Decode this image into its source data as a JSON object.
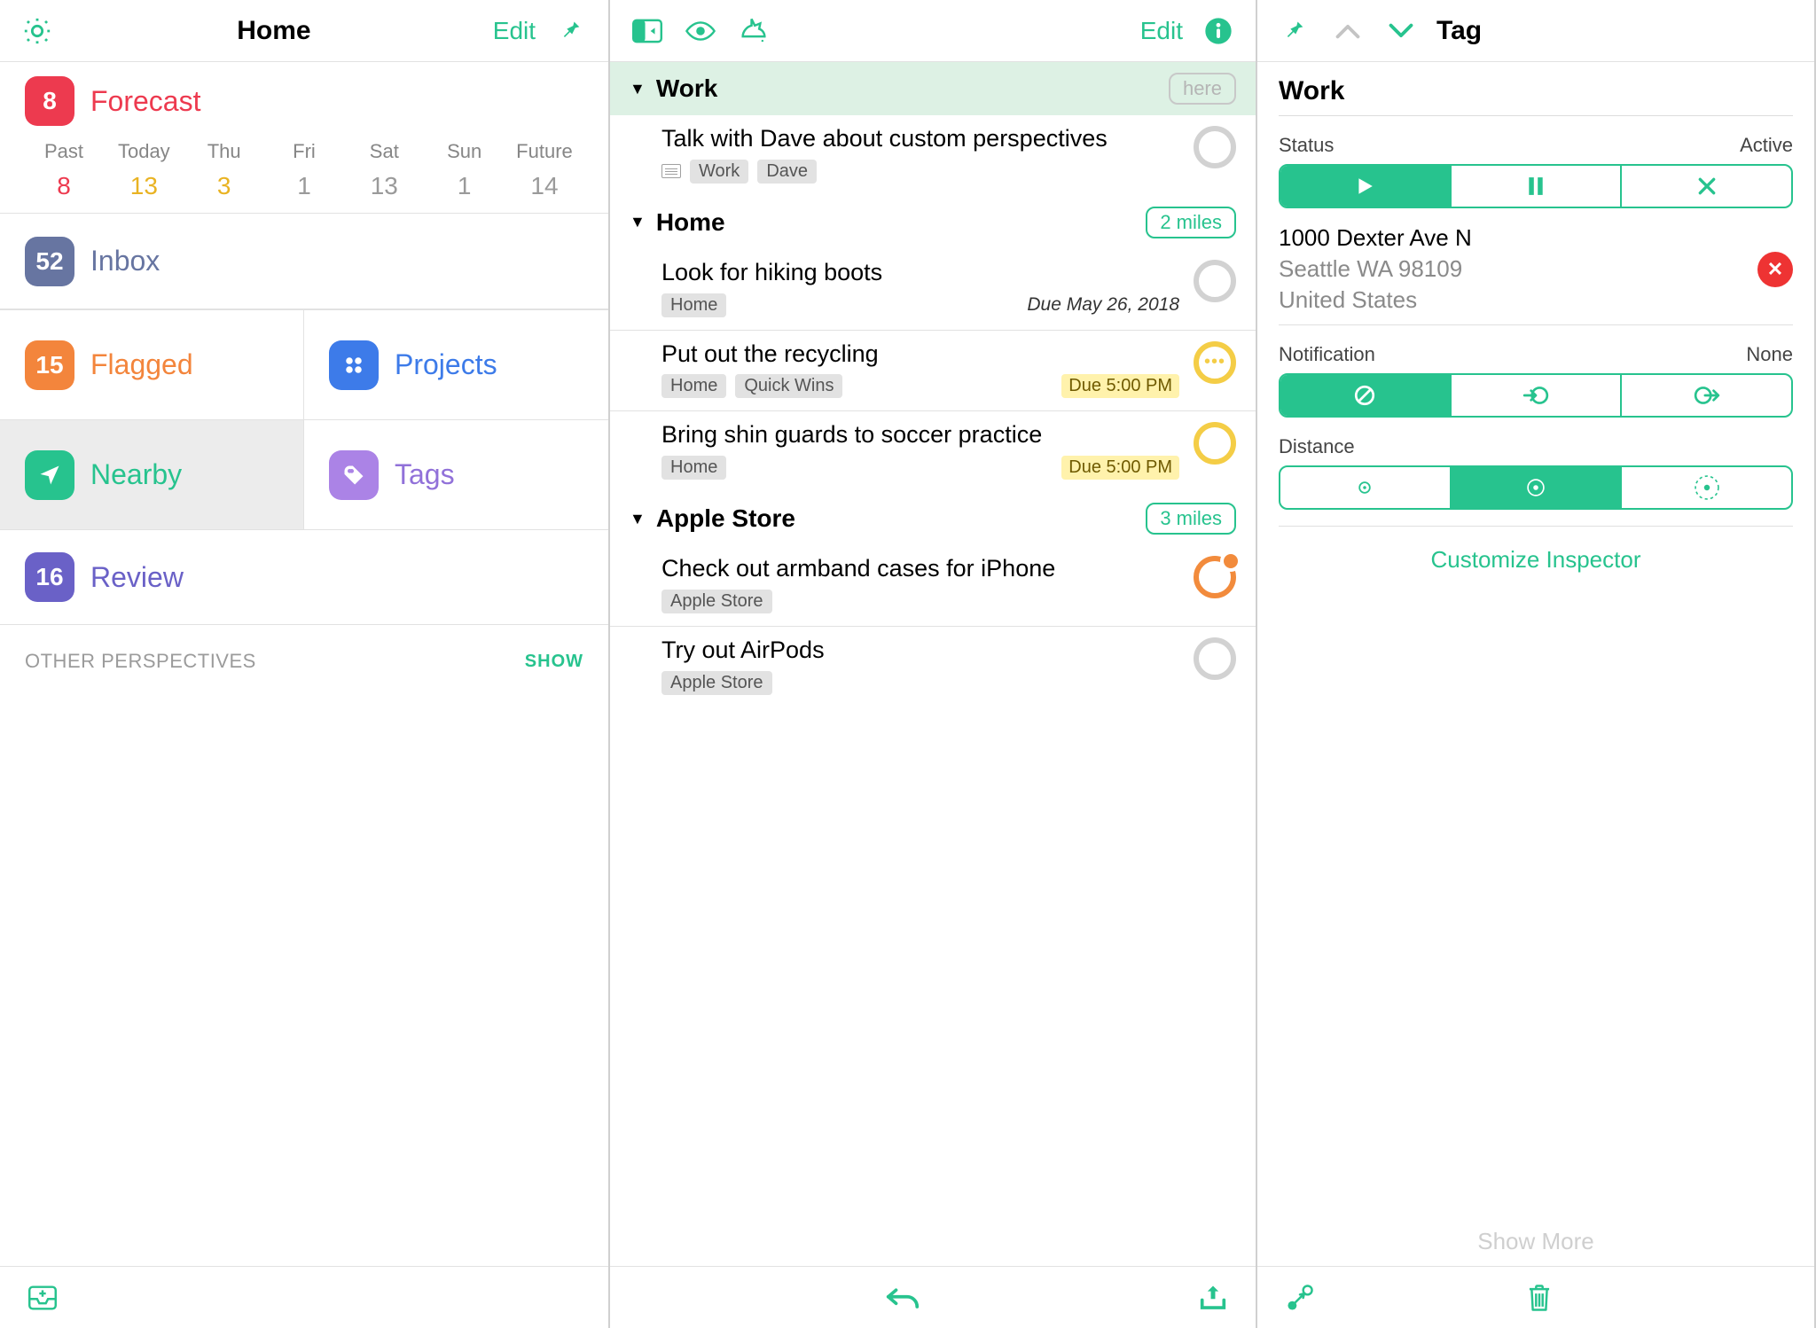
{
  "home": {
    "title": "Home",
    "edit": "Edit",
    "forecast": {
      "label": "Forecast",
      "count": "8",
      "days": [
        {
          "name": "Past",
          "value": "8",
          "color": "#ed3a4f"
        },
        {
          "name": "Today",
          "value": "13",
          "color": "#e9b323"
        },
        {
          "name": "Thu",
          "value": "3",
          "color": "#e9b323"
        },
        {
          "name": "Fri",
          "value": "1",
          "color": "#9a9a9a"
        },
        {
          "name": "Sat",
          "value": "13",
          "color": "#9a9a9a"
        },
        {
          "name": "Sun",
          "value": "1",
          "color": "#9a9a9a"
        },
        {
          "name": "Future",
          "value": "14",
          "color": "#9a9a9a"
        }
      ]
    },
    "inbox": {
      "label": "Inbox",
      "count": "52"
    },
    "flagged": {
      "label": "Flagged",
      "count": "15"
    },
    "projects": {
      "label": "Projects"
    },
    "nearby": {
      "label": "Nearby"
    },
    "tags": {
      "label": "Tags"
    },
    "review": {
      "label": "Review",
      "count": "16"
    },
    "otherPerspectives": "OTHER PERSPECTIVES",
    "show": "SHOW"
  },
  "list": {
    "edit": "Edit",
    "groups": [
      {
        "name": "Work",
        "pill": "here",
        "pillStyle": "gray",
        "highlight": true,
        "tasks": [
          {
            "title": "Talk with Dave about custom perspectives",
            "note": true,
            "tags": [
              "Work",
              "Dave"
            ],
            "circle": "gray"
          }
        ]
      },
      {
        "name": "Home",
        "pill": "2 miles",
        "pillStyle": "teal",
        "tasks": [
          {
            "title": "Look for hiking boots",
            "tags": [
              "Home"
            ],
            "metaRight": "Due May 26, 2018",
            "metaStyle": "italic",
            "circle": "gray"
          },
          {
            "title": "Put out the recycling",
            "tags": [
              "Home",
              "Quick Wins"
            ],
            "due": "Due 5:00 PM",
            "circle": "yellow-dots"
          },
          {
            "title": "Bring shin guards to soccer practice",
            "tags": [
              "Home"
            ],
            "due": "Due 5:00 PM",
            "circle": "yellow"
          }
        ]
      },
      {
        "name": "Apple Store",
        "pill": "3 miles",
        "pillStyle": "teal",
        "tasks": [
          {
            "title": "Check out armband cases for iPhone",
            "tags": [
              "Apple Store"
            ],
            "circle": "orange-flag"
          },
          {
            "title": "Try out AirPods",
            "tags": [
              "Apple Store"
            ],
            "circle": "gray"
          }
        ]
      }
    ]
  },
  "inspector": {
    "header": "Tag",
    "title": "Work",
    "status": {
      "label": "Status",
      "value": "Active",
      "selected": 0
    },
    "address": {
      "line1": "1000 Dexter Ave N",
      "line2": "Seattle WA 98109",
      "line3": "United States"
    },
    "notification": {
      "label": "Notification",
      "value": "None",
      "selected": 0
    },
    "distance": {
      "label": "Distance",
      "selected": 1
    },
    "customize": "Customize Inspector",
    "showMore": "Show More"
  }
}
